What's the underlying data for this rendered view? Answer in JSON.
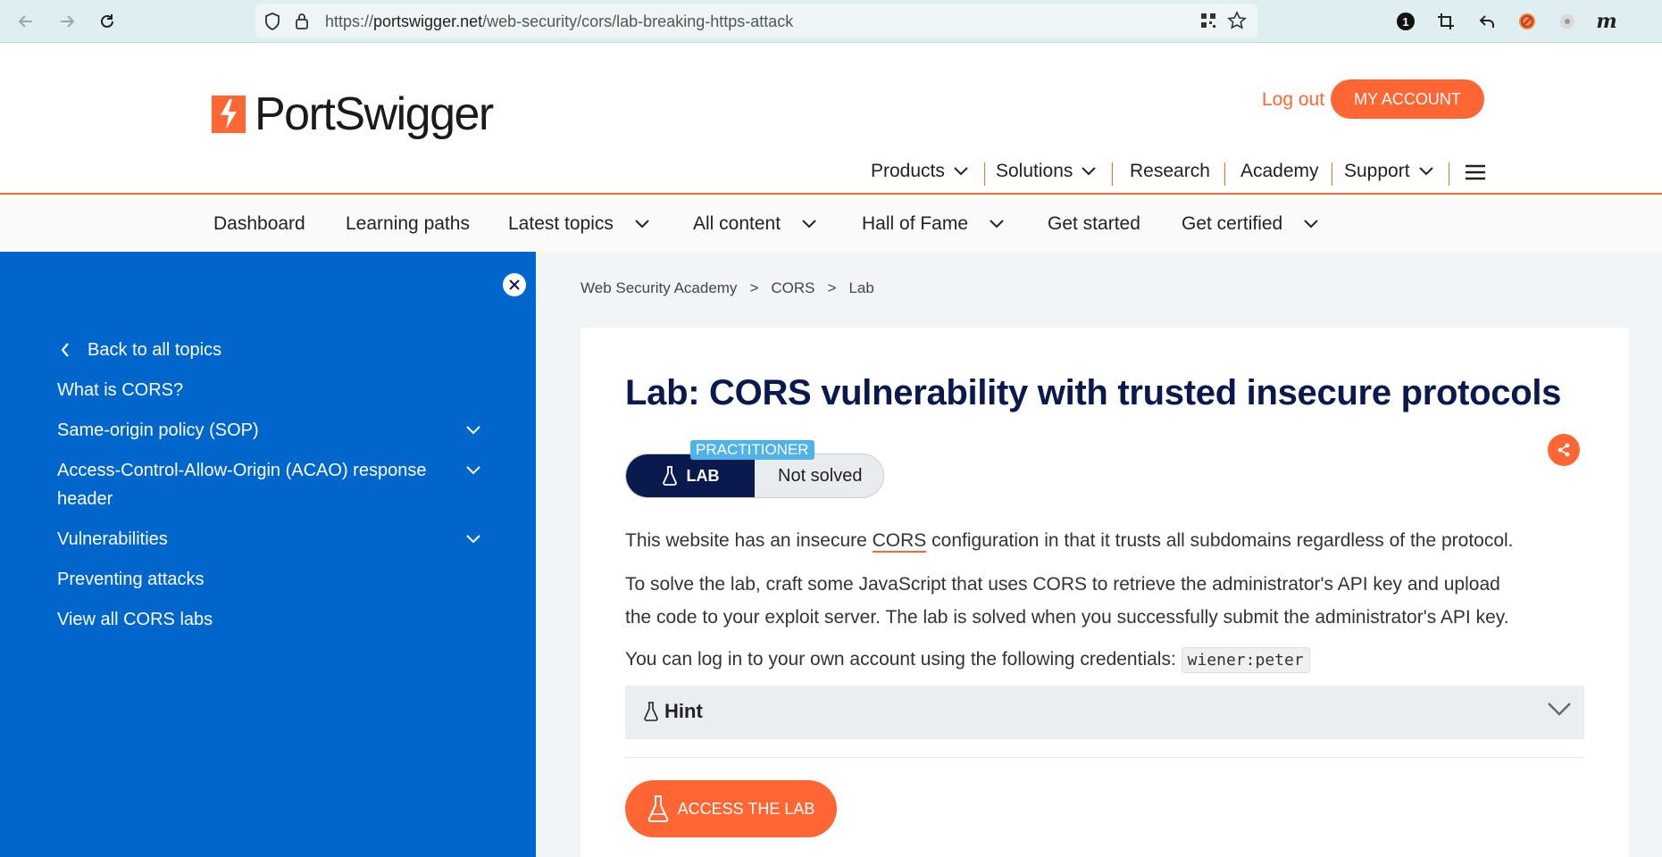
{
  "browser": {
    "url_prefix": "https://",
    "url_host": "portswigger.net",
    "url_path": "/web-security/cors/lab-breaking-https-attack",
    "ext_badge": "1",
    "ext_m": "m"
  },
  "header": {
    "logo_text": "PortSwigger",
    "logout": "Log out",
    "my_account": "MY ACCOUNT",
    "main_nav": [
      "Products",
      "Solutions",
      "Research",
      "Academy",
      "Support"
    ]
  },
  "subnav": [
    "Dashboard",
    "Learning paths",
    "Latest topics",
    "All content",
    "Hall of Fame",
    "Get started",
    "Get certified"
  ],
  "sidebar": {
    "back": "Back to all topics",
    "items": [
      "What is CORS?",
      "Same-origin policy (SOP)",
      "Access-Control-Allow-Origin (ACAO) response",
      "header",
      "Vulnerabilities",
      "Preventing attacks",
      "View all CORS labs"
    ]
  },
  "breadcrumb": [
    "Web Security Academy",
    ">",
    "CORS",
    ">",
    "Lab"
  ],
  "lab": {
    "title": "Lab: CORS vulnerability with trusted insecure protocols",
    "level": "PRACTITIONER",
    "badge": "LAB",
    "status": "Not solved",
    "p1_a": "This website has an insecure ",
    "p1_link": "CORS",
    "p1_b": " configuration in that it trusts all subdomains regardless of the protocol.",
    "p2_line1": "To solve the lab, craft some JavaScript that uses CORS to retrieve the administrator's API key and upload",
    "p2_line2": "the code to your exploit server. The lab is solved when you successfully submit the administrator's API key.",
    "p3": "You can log in to your own account using the following credentials: ",
    "credentials": "wiener:peter",
    "hint": "Hint",
    "access": "ACCESS THE LAB"
  },
  "colors": {
    "brand": "#ff6633",
    "sidebar": "#0066cc",
    "navy": "#0a1a4e",
    "level": "#4fb3ea"
  }
}
